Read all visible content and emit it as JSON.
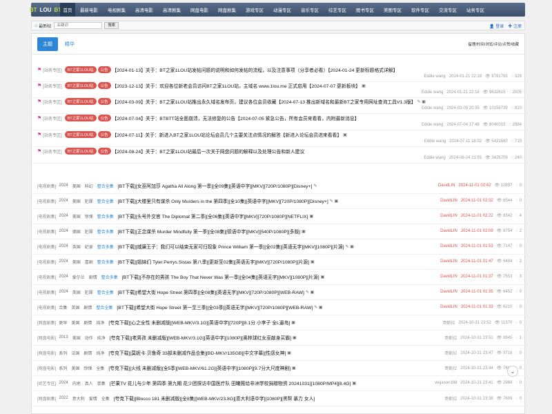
{
  "logo": {
    "p1": "BT",
    "p2": "LOU",
    "p3": "BT"
  },
  "nav": [
    "首页",
    "最新电影",
    "电视剧集",
    "高清电影",
    "高清剧集",
    "网盘电影",
    "网盘剧集",
    "游戏专区",
    "动漫专区",
    "音乐专区",
    "综艺专区",
    "图书专区",
    "美图专区",
    "软件专区",
    "交流专区",
    "站务专区"
  ],
  "crumb": "最新帖",
  "search": {
    "placeholder": "关键词",
    "button": "搜索"
  },
  "auth": {
    "login": "登录",
    "register": "注册"
  },
  "tabs": {
    "main": "主题",
    "other": "精华",
    "sort": "留理/时间/浏览/评论/点赞/收藏"
  },
  "sticky": [
    {
      "cat": "[站务专区]",
      "badges": [
        "BT之家1LOU站",
        "公告"
      ],
      "title": "【2024-01-13】关于：BT之家1LOU站发帖问题的说明和如何发帖的流程，以及注意事项（分享者必看）【2024-01-24 更新标题格式详解】",
      "icons": "",
      "author": "Eddie wang",
      "date": "2024-01-21 22:18",
      "views": "8781783",
      "comments": "329"
    },
    {
      "cat": "[站务专区]",
      "badges": [
        "BT之家1LOU站",
        "公告"
      ],
      "title": "【2023-12-13】关于：欢迎各位新老会员访问BT之家1LOU站，主域名 www.1lou.me 正式启用【2024-07-07 更新板块】",
      "icons": "▣",
      "author": "Eddie wang",
      "date": "2024-01-21 22:18",
      "views": "9632615",
      "comments": "2005"
    },
    {
      "cat": "[站务专区]",
      "badges": [
        "BT之家1LOU站",
        "公告"
      ],
      "title": "【2024-03-09】关于：BT之家1LOU站推出永久域名发布页，建议各位会员收藏【2024-07-13 推出新域名和最新BT之家专用网址查询工具V1.3版】",
      "icons": "✎ ▣",
      "author": "Eddie wang",
      "date": "2024-03-09 20:35",
      "views": "10159739",
      "comments": "810"
    },
    {
      "cat": "[站务专区]",
      "badges": [
        "BT之家1LOU站",
        "公告"
      ],
      "title": "【2024-07-04】关于：BTBTT站全面崩溃，无法修复的公告【2024-07-05 紧急公告，所有会员来看看，内附最新消息】",
      "icons": "",
      "author": "Eddie wang",
      "date": "2024-07-04 17:48",
      "views": "8040015",
      "comments": "2984"
    },
    {
      "cat": "[站务专区]",
      "badges": [
        "BT之家1LOU站",
        "公告"
      ],
      "title": "【2024-07-11】关于：新进入BT之家1LOU站论坛会员几个主要关注点情况的解答【新进入论坛会员进来看看】",
      "icons": "▣",
      "author": "Eddie wang",
      "date": "2024-07-11 18:02",
      "views": "5421560",
      "comments": "719"
    },
    {
      "cat": "[站务专区]",
      "badges": [
        "BT之家1LOU站",
        "公告"
      ],
      "title": "【2024-08-24】关于：BT之家1LOU站最后一次关于网盘问题的解释以及处理公告和新人建议",
      "icons": "",
      "author": "Eddie wang",
      "date": "2024-08-24 21:55",
      "views": "3426709",
      "comments": "240"
    }
  ],
  "posts": [
    {
      "cat": "[电视剧集]",
      "tags": [
        "2024",
        "美国",
        "科幻"
      ],
      "blue": "整合全集",
      "title": "[BT下载][女巫阿加莎 Agatha All Along 第一季][全09集][英语中字][MKV][720P/1080P][Disney+]",
      "icons": "✎",
      "author": "DavidLIN",
      "date": "2024-11-01 02:42",
      "views": "10897",
      "comments": "0",
      "red": true
    },
    {
      "cat": "[电视剧集]",
      "tags": [
        "2024",
        "美国",
        "犯罪"
      ],
      "blue": "整合全集",
      "title": "[BT下载][大楼里只有谋杀 Only Murders in the 第四季][全10集][英语中字][MKV][720P/1080P][Disney+]",
      "icons": "✎ ▣",
      "author": "DavidLIN",
      "date": "2024-11-01 02:32",
      "views": "6544",
      "comments": "0",
      "red": true
    },
    {
      "cat": "[电视剧集]",
      "tags": [
        "2024",
        "美国",
        "惊悚"
      ],
      "blue": "整合多集",
      "title": "[BT下载][头号外交官 The Diplomat 第二季][全06集][英语中字][MKV][720P/1080P][NETFLIX]",
      "icons": "▣",
      "author": "DavidLIN",
      "date": "2024-11-01 02:22",
      "views": "8342",
      "comments": "4",
      "red": true
    },
    {
      "cat": "[电视剧集]",
      "tags": [
        "2024",
        "德国",
        "犯罪"
      ],
      "blue": "整合多集",
      "title": "[BT下载][正念谋杀 Murder Mindfully 第一季][全08集][德语中字][MKV][540P/1080P][多版]",
      "icons": "▣",
      "author": "DavidLIN",
      "date": "2024-11-01 02:09",
      "views": "8754",
      "comments": "2",
      "red": true
    },
    {
      "cat": "[电视剧集]",
      "tags": [
        "2024",
        "英国",
        "纪录"
      ],
      "blue": "整合多集",
      "title": "[BT下载][威廉王子：我们可以结束无家可归现象 Prince William 第一季][全02集][英语无字][MKV][1080P][片源]",
      "icons": "✎ ▣",
      "author": "DavidLIN",
      "date": "2024-11-01 01:53",
      "views": "7147",
      "comments": "0",
      "red": true
    },
    {
      "cat": "[电视剧集]",
      "tags": [
        "2024",
        "美国",
        "喜剧"
      ],
      "blue": "整合多集",
      "title": "[BT下载][姐妹们 Tyler.Perrys.Sistas 第八季][更新至02集][英语无字][MKV][720P/1080P][片源]",
      "icons": "▣",
      "author": "DavidLIN",
      "date": "2024-11-01 01:47",
      "views": "6484",
      "comments": "3",
      "red": true
    },
    {
      "cat": "[电视剧集]",
      "tags": [
        "2024",
        "爱尔兰",
        "剧情"
      ],
      "blue": "整合多集",
      "title": "[BT下载][不存在的男孩 The Boy That Never Was 第一季][全04集][英语无字][MKV][1080P][片源]",
      "icons": "▣",
      "author": "DavidLIN",
      "date": "2024-11-01 01:37",
      "views": "7553",
      "comments": "3",
      "red": true
    },
    {
      "cat": "[电视剧集]",
      "tags": [
        "2024",
        "英国",
        "犯罪"
      ],
      "blue": "整合全集",
      "title": "[BT下载][希望大街 Hope Street 第四季][全08集][英语无字][MKV][720P/1080P][WEB-RAW]",
      "icons": "✎ ▣",
      "author": "DavidLIN",
      "date": "2024-11-01 01:35",
      "views": "6452",
      "comments": "0",
      "red": true
    },
    {
      "cat": "[电视剧集]",
      "tags": [
        "合集",
        "英国",
        "剧情"
      ],
      "blue": "整合全集",
      "title": "[BT下载][希望大街 Hope Street 第一至三季][全03季][英语无字][MKV][720P/1080P][WEB-RAW]",
      "icons": "✎ ▣",
      "author": "DavidLIN",
      "date": "2024-11-01 01:33",
      "views": "6210",
      "comments": "0",
      "red": true
    },
    {
      "cat": "[网盘剧集]",
      "tags": [
        "更早",
        "美国",
        "剧情",
        "纯净"
      ],
      "blue": "",
      "title": "[夸克下载][心之全性 未删减版][WEB-MKV/3.1G][英语中字][720P][8.1分 小李子 全L逼岛]",
      "icons": "▣",
      "author": "哥斯拉",
      "date": "2024-10-31 23:52",
      "views": "11370",
      "comments": "0",
      "red": false
    },
    {
      "cat": "[网盘电影]",
      "tags": [
        "2013",
        "美国",
        "动作",
        "纯净"
      ],
      "blue": "",
      "title": "[夸克下载][老男孩 未删减版][WEB-MKV/3.1G][英语中字][1080P][奥林球红女巫献身买霸]",
      "icons": "▣",
      "author": "哥斯拉",
      "date": "2024-10-31 23:51",
      "views": "8945",
      "comments": "1",
      "red": false
    },
    {
      "cat": "[网盘电影]",
      "tags": [
        "系列",
        "法国",
        "剧情",
        "纯净"
      ],
      "blue": "",
      "title": "[夸克下载][莫妮卡·贝鲁奇 33部未删减作品合集][BD-MKV/135GB][中文字幕][性感女神]",
      "icons": "▣",
      "author": "哥斯拉",
      "date": "2024-10-31 23:47",
      "views": "9716",
      "comments": "0",
      "red": false
    },
    {
      "cat": "[网盘电影]",
      "tags": [
        "系列",
        "美国",
        "惊悚",
        "全集"
      ],
      "blue": "",
      "title": "[夸克下载][火线 未删减版][全5季][WEB-MKV/61.2G][英语中字][1080P][9.7分大尺度神剧]",
      "icons": "▣",
      "author": "哥斯拉",
      "date": "2024-10-31 23:44",
      "views": "7681",
      "comments": "0",
      "red": false
    },
    {
      "cat": "[综艺专区]",
      "tags": [
        "2024",
        "内地",
        "真人",
        "单集"
      ],
      "blue": "",
      "title": "[芒果TV 花儿与少年 第四季 第九期 花少团探访中国医疗队 田曦薇给非洲学校捐赠物资 20241031][1080P/MP4][8.4G]",
      "icons": "▣",
      "author": "wujason168",
      "date": "2024-10-31 23:41",
      "views": "2968",
      "comments": "0",
      "red": false
    },
    {
      "cat": "[网盘剧集]",
      "tags": [
        "2022",
        "意大利",
        "爱情",
        "全集"
      ],
      "blue": "",
      "title": "[夸克下载][Blocco 181 未删减版][全8集][WEB-MKV/23.8G][意大利语中字][1080P][黑帮 暴力 女人]",
      "icons": "",
      "author": "哥斯拉",
      "date": "2024-10-31 23:38",
      "views": "7609",
      "comments": "0",
      "red": false
    }
  ]
}
